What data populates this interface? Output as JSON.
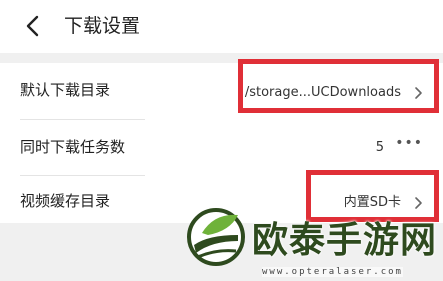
{
  "header": {
    "back_icon": "chevron-left-icon",
    "title": "下载设置"
  },
  "settings": [
    {
      "label": "默认下载目录",
      "value": "/storage...UCDownloads",
      "control": "chevron-right-icon"
    },
    {
      "label": "同时下载任务数",
      "value": "5",
      "control": "more-dots-icon",
      "control_text": "•••"
    },
    {
      "label": "视频缓存目录",
      "value": "内置SD卡",
      "control": "chevron-right-icon"
    }
  ],
  "watermark": {
    "name": "欧泰手游网",
    "url": "www.opteralaser.com"
  },
  "colors": {
    "highlight_border": "#e02f37",
    "background": "#f0f0f0",
    "panel": "#ffffff",
    "watermark_text": "#2e4a1e"
  }
}
